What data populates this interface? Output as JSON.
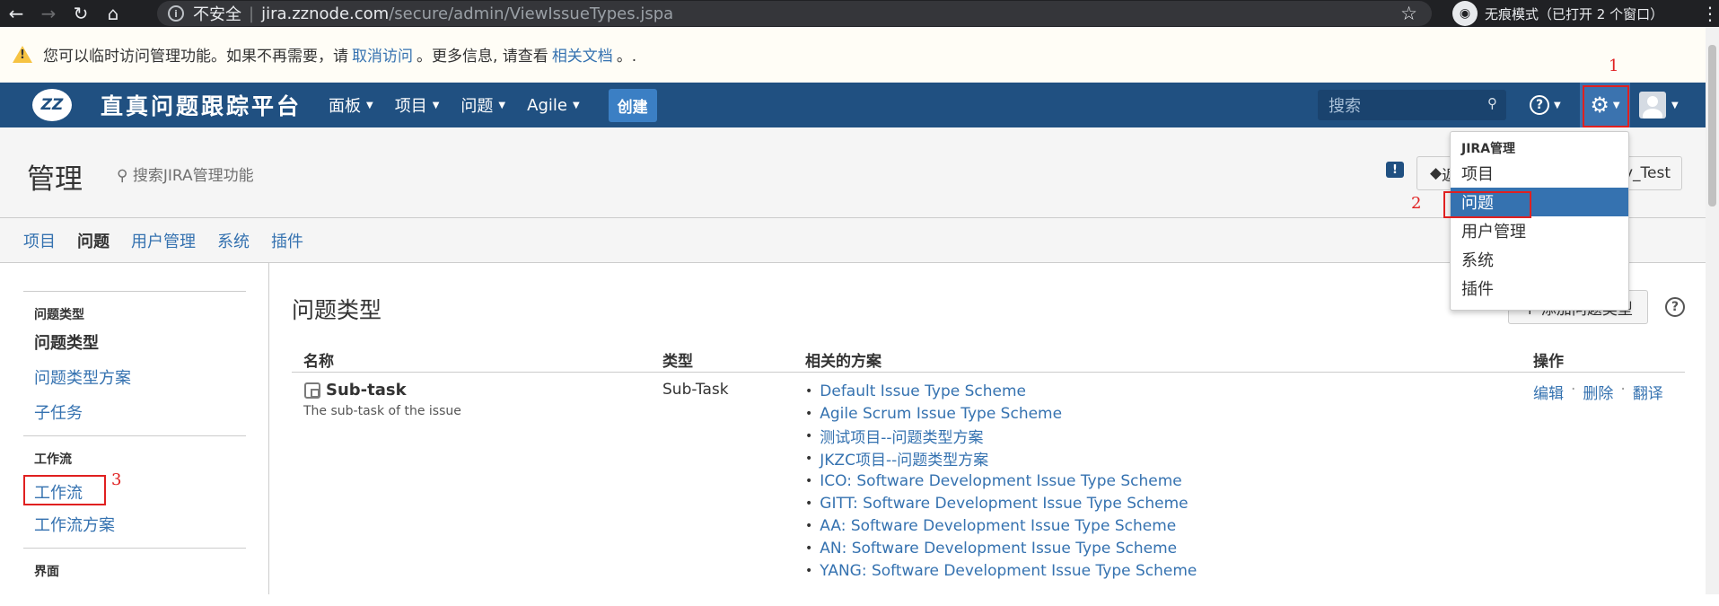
{
  "browser": {
    "insecure_label": "不安全",
    "url_host": "jira.zznode.com",
    "url_path": "/secure/admin/ViewIssueTypes.jspa",
    "incognito_label": "无痕模式（已打开 2 个窗口）"
  },
  "banner": {
    "text1": "您可以临时访问管理功能。如果不再需要，请",
    "link1": "取消访问",
    "text2": "。更多信息, 请查看",
    "link2": "相关文档",
    "text3": "。."
  },
  "header": {
    "logo_text": "ZZ",
    "brand": "直真问题跟踪平台",
    "nav": [
      {
        "label": "面板"
      },
      {
        "label": "项目"
      },
      {
        "label": "问题"
      },
      {
        "label": "Agile"
      }
    ],
    "create_label": "创建",
    "search_placeholder": "搜索"
  },
  "admin": {
    "title": "管理",
    "search_label": "搜索JIRA管理功能",
    "back_label": "返回",
    "project_label": "y_Test",
    "tabs": [
      {
        "label": "项目"
      },
      {
        "label": "问题"
      },
      {
        "label": "用户管理"
      },
      {
        "label": "系统"
      },
      {
        "label": "插件"
      }
    ]
  },
  "dropdown": {
    "heading": "JIRA管理",
    "items": [
      {
        "label": "项目"
      },
      {
        "label": "问题"
      },
      {
        "label": "用户管理"
      },
      {
        "label": "系统"
      },
      {
        "label": "插件"
      }
    ]
  },
  "sidebar": {
    "group1_title": "问题类型",
    "group1_items": [
      {
        "label": "问题类型"
      },
      {
        "label": "问题类型方案"
      },
      {
        "label": "子任务"
      }
    ],
    "group2_title": "工作流",
    "group2_items": [
      {
        "label": "工作流"
      },
      {
        "label": "工作流方案"
      }
    ],
    "group3_title": "界面"
  },
  "main": {
    "page_title": "问题类型",
    "add_label": "+ 添加问题类型",
    "columns": {
      "name": "名称",
      "type": "类型",
      "schemes": "相关的方案",
      "ops": "操作"
    },
    "rows": [
      {
        "name": "Sub-task",
        "desc": "The sub-task of the issue",
        "type": "Sub-Task",
        "schemes": [
          "Default Issue Type Scheme",
          "Agile Scrum Issue Type Scheme",
          "测试项目--问题类型方案",
          "JKZC项目--问题类型方案",
          "ICO: Software Development Issue Type Scheme",
          "GITT: Software Development Issue Type Scheme",
          "AA: Software Development Issue Type Scheme",
          "AN: Software Development Issue Type Scheme",
          "YANG: Software Development Issue Type Scheme"
        ],
        "ops": {
          "edit": "编辑",
          "delete": "删除",
          "translate": "翻译"
        }
      }
    ]
  },
  "annotations": {
    "one": "1",
    "two": "2",
    "three": "3"
  },
  "colors": {
    "header_bg": "#205081",
    "link": "#3572b0",
    "annotation_red": "#e02020"
  }
}
